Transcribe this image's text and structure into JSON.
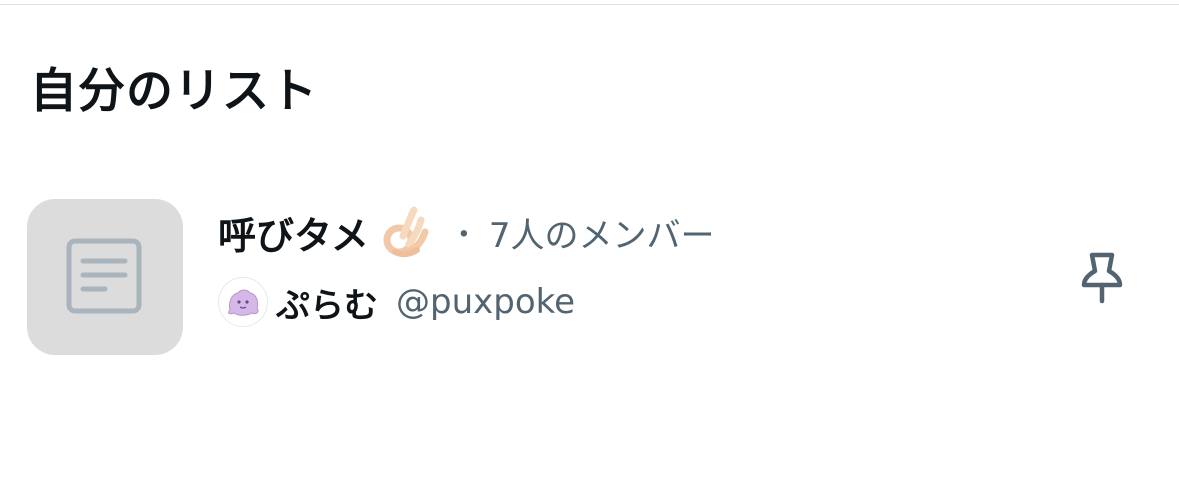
{
  "page": {
    "title": "自分のリスト"
  },
  "list": {
    "name": "呼びタメ",
    "name_emoji": "ok-hand-emoji",
    "separator": "・",
    "member_count": "7人のメンバー",
    "thumbnail_icon": "list-document-icon",
    "owner": {
      "display_name": "ぷらむ",
      "handle": "@puxpoke",
      "avatar": "purple-blob-avatar"
    },
    "pin_icon": "pin-icon"
  },
  "colors": {
    "text_primary": "#0f1419",
    "text_secondary": "#536471",
    "thumb_bg": "#dcdcdc",
    "thumb_icon": "#aab4bd",
    "pin": "#536471"
  }
}
